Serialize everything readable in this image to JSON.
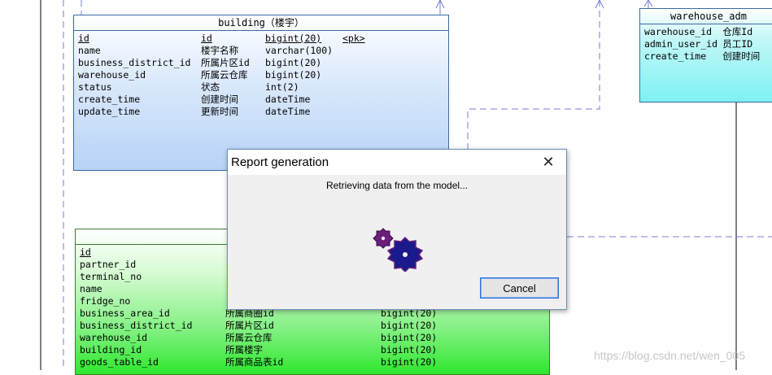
{
  "diagram": {
    "building_table": {
      "title": "building（楼宇）",
      "rows": [
        {
          "code": "id",
          "name": "id",
          "type": "bigint(20)",
          "key": "<pk>"
        },
        {
          "code": "name",
          "name": "楼宇名称",
          "type": "varchar(100)",
          "key": ""
        },
        {
          "code": "business_district_id",
          "name": "所属片区id",
          "type": "bigint(20)",
          "key": ""
        },
        {
          "code": "warehouse_id",
          "name": "所属云仓库",
          "type": "bigint(20)",
          "key": ""
        },
        {
          "code": "status",
          "name": "状态",
          "type": "int(2)",
          "key": ""
        },
        {
          "code": "create_time",
          "name": "创建时间",
          "type": "dateTime",
          "key": ""
        },
        {
          "code": "update_time",
          "name": "更新时间",
          "type": "dateTime",
          "key": ""
        }
      ]
    },
    "warehouse_admin_table": {
      "title": "warehouse_adm",
      "rows": [
        {
          "code": "warehouse_id",
          "name": "仓库Id"
        },
        {
          "code": "admin_user_id",
          "name": "员工ID"
        },
        {
          "code": "create_time",
          "name": "创建时间"
        }
      ]
    },
    "fridge_table": {
      "title": "",
      "rows": [
        {
          "code": "id",
          "name": "",
          "type": ""
        },
        {
          "code": "partner_id",
          "name": "",
          "type": ""
        },
        {
          "code": "terminal_no",
          "name": "",
          "type": ""
        },
        {
          "code": "name",
          "name": "",
          "type": ""
        },
        {
          "code": "fridge_no",
          "name": "",
          "type": ""
        },
        {
          "code": "business_area_id",
          "name": "所属商圈id",
          "type": "bigint(20)"
        },
        {
          "code": "business_district_id",
          "name": "所属片区id",
          "type": "bigint(20)"
        },
        {
          "code": "warehouse_id",
          "name": "所属云仓库",
          "type": "bigint(20)"
        },
        {
          "code": "building_id",
          "name": "所属楼宇",
          "type": "bigint(20)"
        },
        {
          "code": "goods_table_id",
          "name": "所属商品表id",
          "type": "bigint(20)"
        }
      ]
    }
  },
  "dialog": {
    "title": "Report generation",
    "message": "Retrieving data from the model...",
    "cancel_label": "Cancel",
    "close_glyph": "✕"
  },
  "watermark": "https://blog.csdn.net/wen_005",
  "colors": {
    "dashed_line": "#7b7bd6",
    "gear_small": "#6a1f7a",
    "gear_large": "#1a1a8c"
  }
}
